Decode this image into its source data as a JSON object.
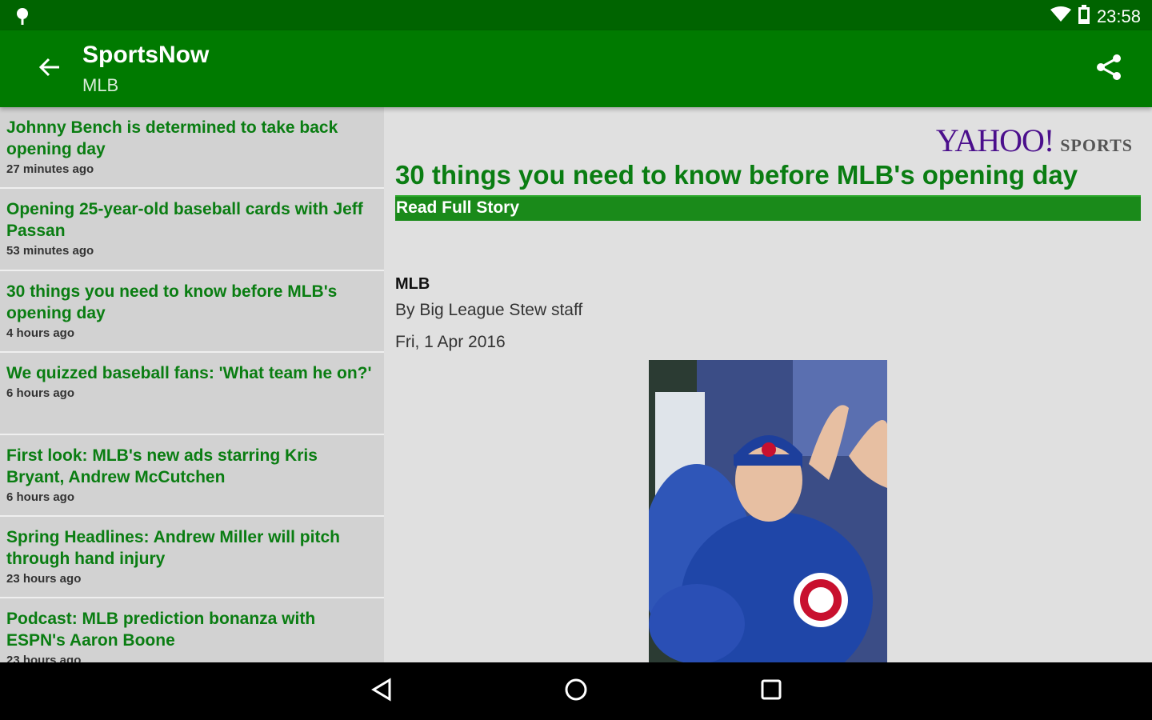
{
  "status": {
    "time": "23:58"
  },
  "app_bar": {
    "title": "SportsNow",
    "subtitle": "MLB"
  },
  "sidebar": {
    "items": [
      {
        "title": "Johnny Bench is determined to take back opening day",
        "time": "27 minutes ago"
      },
      {
        "title": "Opening 25-year-old baseball cards with Jeff Passan",
        "time": "53 minutes ago"
      },
      {
        "title": "30 things you need to know before MLB's opening day",
        "time": "4 hours ago"
      },
      {
        "title": "We quizzed baseball fans: 'What team he on?'",
        "time": "6 hours ago"
      },
      {
        "title": "First look: MLB's new ads starring Kris Bryant, Andrew McCutchen",
        "time": "6 hours ago"
      },
      {
        "title": "Spring Headlines: Andrew Miller will pitch through hand injury",
        "time": "23 hours ago"
      },
      {
        "title": "Podcast: MLB prediction bonanza with ESPN's Aaron Boone",
        "time": "23 hours ago"
      }
    ]
  },
  "article": {
    "logo_main": "YAHOO!",
    "logo_sub": "SPORTS",
    "title": "30 things you need to know before MLB's opening day",
    "read_full_story": "Read Full Story",
    "category": "MLB",
    "author": "By Big League Stew staff",
    "date": "Fri, 1 Apr 2016"
  },
  "colors": {
    "status_bar": "#006400",
    "app_bar": "#007a00",
    "accent_green": "#0a7d12",
    "read_bar": "#1a8a1a"
  },
  "icons": {
    "status_left": "location-pin-icon",
    "wifi": "wifi-icon",
    "battery": "battery-icon",
    "back": "arrow-left-icon",
    "share": "share-icon",
    "nav_back": "triangle-back-icon",
    "nav_home": "circle-home-icon",
    "nav_recents": "square-recents-icon"
  }
}
